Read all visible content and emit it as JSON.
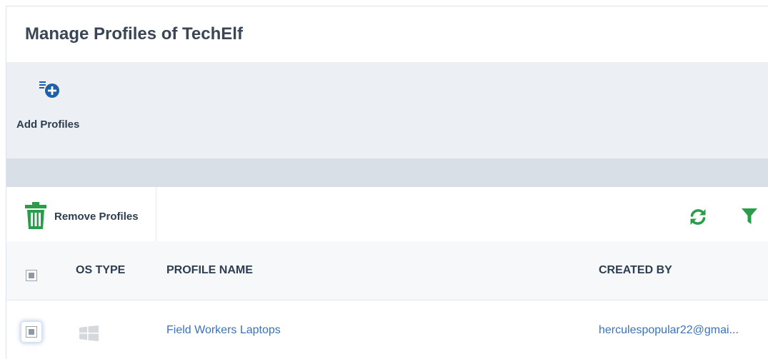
{
  "page": {
    "title": "Manage Profiles of TechElf"
  },
  "actions": {
    "add_profiles_label": "Add Profiles"
  },
  "toolbar": {
    "remove_profiles_label": "Remove Profiles"
  },
  "table": {
    "columns": [
      "OS TYPE",
      "PROFILE NAME",
      "CREATED BY"
    ],
    "rows": [
      {
        "os_type": "windows-icon",
        "profile_name": "Field Workers Laptops",
        "created_by": "herculespopular22@gmai..."
      }
    ]
  },
  "colors": {
    "accent_green": "#2a9d4b",
    "link_blue": "#3a73b8",
    "icon_blue": "#1f5fa8"
  }
}
